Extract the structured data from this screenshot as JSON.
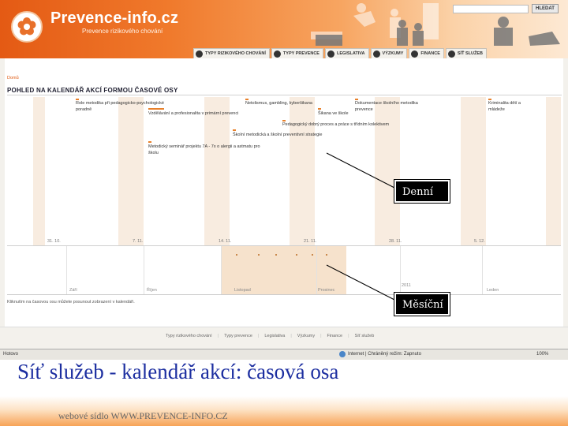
{
  "site": {
    "logo_text": "Prevence-info.cz",
    "logo_sub": "Prevence rizikového chování",
    "search_button": "HLEDAT",
    "tabs": [
      {
        "label": "TYPY RIZIKOVÉHO CHOVÁNÍ",
        "icon": "R"
      },
      {
        "label": "TYPY PREVENCE",
        "icon": "P"
      },
      {
        "label": "LEGISLATIVA",
        "icon": "L"
      },
      {
        "label": "VÝZKUMY",
        "icon": "V"
      },
      {
        "label": "FINANCE",
        "icon": "F"
      },
      {
        "label": "SÍŤ SLUŽEB",
        "icon": "S"
      }
    ]
  },
  "page": {
    "breadcrumb": "Domů",
    "title": "POHLED NA KALENDÁŘ AKCÍ FORMOU ČASOVÉ OSY",
    "events": [
      {
        "text": "Role metodika při pedagogicko-psychologické",
        "text2": "poradně"
      },
      {
        "text": "Vzdělávání a profesionalita v primární prevenci"
      },
      {
        "text": "Metodický seminář projektu 7A - 7x o alergii a astmatu pro",
        "text2": "školu"
      },
      {
        "text": "Netolismus, gambling, kyberšikana"
      },
      {
        "text": "Šikana ve škole"
      },
      {
        "text": "Pedagogický dobrý proces a práce s třídním kolektivem"
      },
      {
        "text": "Školní metodická a školní preventivní strategie"
      },
      {
        "text": "Dokumentace školního metodika",
        "text2": "prevence"
      },
      {
        "text": "Kriminalita dětí a",
        "text2": "mládeže"
      }
    ],
    "days": [
      "31. 10.",
      "7. 11.",
      "14. 11.",
      "21. 11.",
      "28. 11.",
      "5. 12."
    ],
    "months": [
      "Září",
      "Říjen",
      "Listopad",
      "Prosinec",
      "2011",
      "Leden"
    ],
    "footnote": "Kliknutím na časovou osu můžete posunout zobrazení v kalendáři.",
    "callout_daily": "Denní",
    "callout_monthly": "Měsíční"
  },
  "footer": {
    "links": [
      "Typy rizikového chování",
      "Typy prevence",
      "Legislativa",
      "Výzkumy",
      "Finance",
      "Síť služeb"
    ]
  },
  "statusbar": {
    "left": "Hotovo",
    "zone": "Internet | Chráněný režim: Zapnuto",
    "zoom": "100%"
  },
  "slide": {
    "caption": "Síť služeb - kalendář akcí: časová osa",
    "url_prefix": "webové sídlo",
    "url": "WWW.PREVENCE-INFO.CZ"
  },
  "colors": {
    "accent": "#e8802a",
    "header": "#f07a2c",
    "caption": "#1c2ea0"
  }
}
